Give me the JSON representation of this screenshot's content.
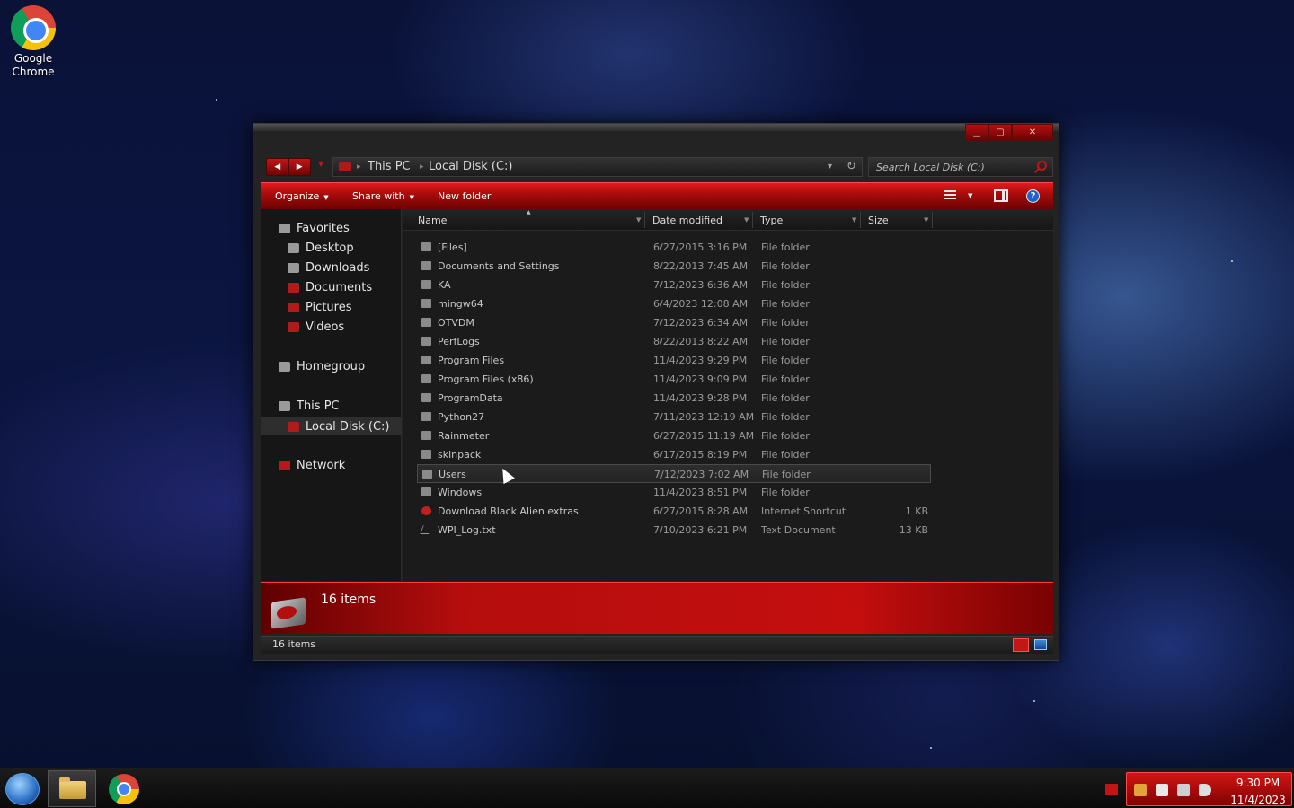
{
  "desktop": {
    "icons": [
      {
        "label": "Google\nChrome",
        "label_line1": "Google",
        "label_line2": "Chrome"
      }
    ]
  },
  "window": {
    "caption_buttons": [
      "minimize",
      "maximize",
      "close"
    ],
    "address": {
      "crumbs": [
        "This PC",
        "Local Disk (C:)"
      ]
    },
    "search": {
      "placeholder": "Search Local Disk (C:)"
    },
    "toolbar": {
      "organize": "Organize",
      "share_with": "Share with",
      "new_folder": "New folder"
    },
    "navigation": {
      "favorites": "Favorites",
      "desktop": "Desktop",
      "downloads": "Downloads",
      "documents": "Documents",
      "pictures": "Pictures",
      "videos": "Videos",
      "homegroup": "Homegroup",
      "this_pc": "This PC",
      "local_disk": "Local Disk (C:)",
      "network": "Network"
    },
    "columns": {
      "name": "Name",
      "date_modified": "Date modified",
      "type": "Type",
      "size": "Size"
    },
    "files": [
      {
        "name": "[Files]",
        "date": "6/27/2015 3:16 PM",
        "type": "File folder",
        "size": ""
      },
      {
        "name": "Documents and Settings",
        "date": "8/22/2013 7:45 AM",
        "type": "File folder",
        "size": ""
      },
      {
        "name": "KA",
        "date": "7/12/2023 6:36 AM",
        "type": "File folder",
        "size": ""
      },
      {
        "name": "mingw64",
        "date": "6/4/2023 12:08 AM",
        "type": "File folder",
        "size": ""
      },
      {
        "name": "OTVDM",
        "date": "7/12/2023 6:34 AM",
        "type": "File folder",
        "size": ""
      },
      {
        "name": "PerfLogs",
        "date": "8/22/2013 8:22 AM",
        "type": "File folder",
        "size": ""
      },
      {
        "name": "Program Files",
        "date": "11/4/2023 9:29 PM",
        "type": "File folder",
        "size": ""
      },
      {
        "name": "Program Files (x86)",
        "date": "11/4/2023 9:09 PM",
        "type": "File folder",
        "size": ""
      },
      {
        "name": "ProgramData",
        "date": "11/4/2023 9:28 PM",
        "type": "File folder",
        "size": ""
      },
      {
        "name": "Python27",
        "date": "7/11/2023 12:19 AM",
        "type": "File folder",
        "size": ""
      },
      {
        "name": "Rainmeter",
        "date": "6/27/2015 11:19 AM",
        "type": "File folder",
        "size": ""
      },
      {
        "name": "skinpack",
        "date": "6/17/2015 8:19 PM",
        "type": "File folder",
        "size": ""
      },
      {
        "name": "Users",
        "date": "7/12/2023 7:02 AM",
        "type": "File folder",
        "size": ""
      },
      {
        "name": "Windows",
        "date": "11/4/2023 8:51 PM",
        "type": "File folder",
        "size": ""
      },
      {
        "name": "Download Black Alien extras",
        "date": "6/27/2015 8:28 AM",
        "type": "Internet Shortcut",
        "size": "1 KB"
      },
      {
        "name": "WPI_Log.txt",
        "date": "7/10/2023 6:21 PM",
        "type": "Text Document",
        "size": "13 KB"
      }
    ],
    "details_pane": {
      "count": "16 items"
    },
    "status_bar": {
      "count": "16 items"
    }
  },
  "taskbar": {
    "clock": {
      "time": "9:30 PM",
      "date": "11/4/2023"
    }
  },
  "colors": {
    "accent_red": "#c40e0e",
    "window_bg": "#1b1b1b",
    "text": "#c8c8c8"
  }
}
